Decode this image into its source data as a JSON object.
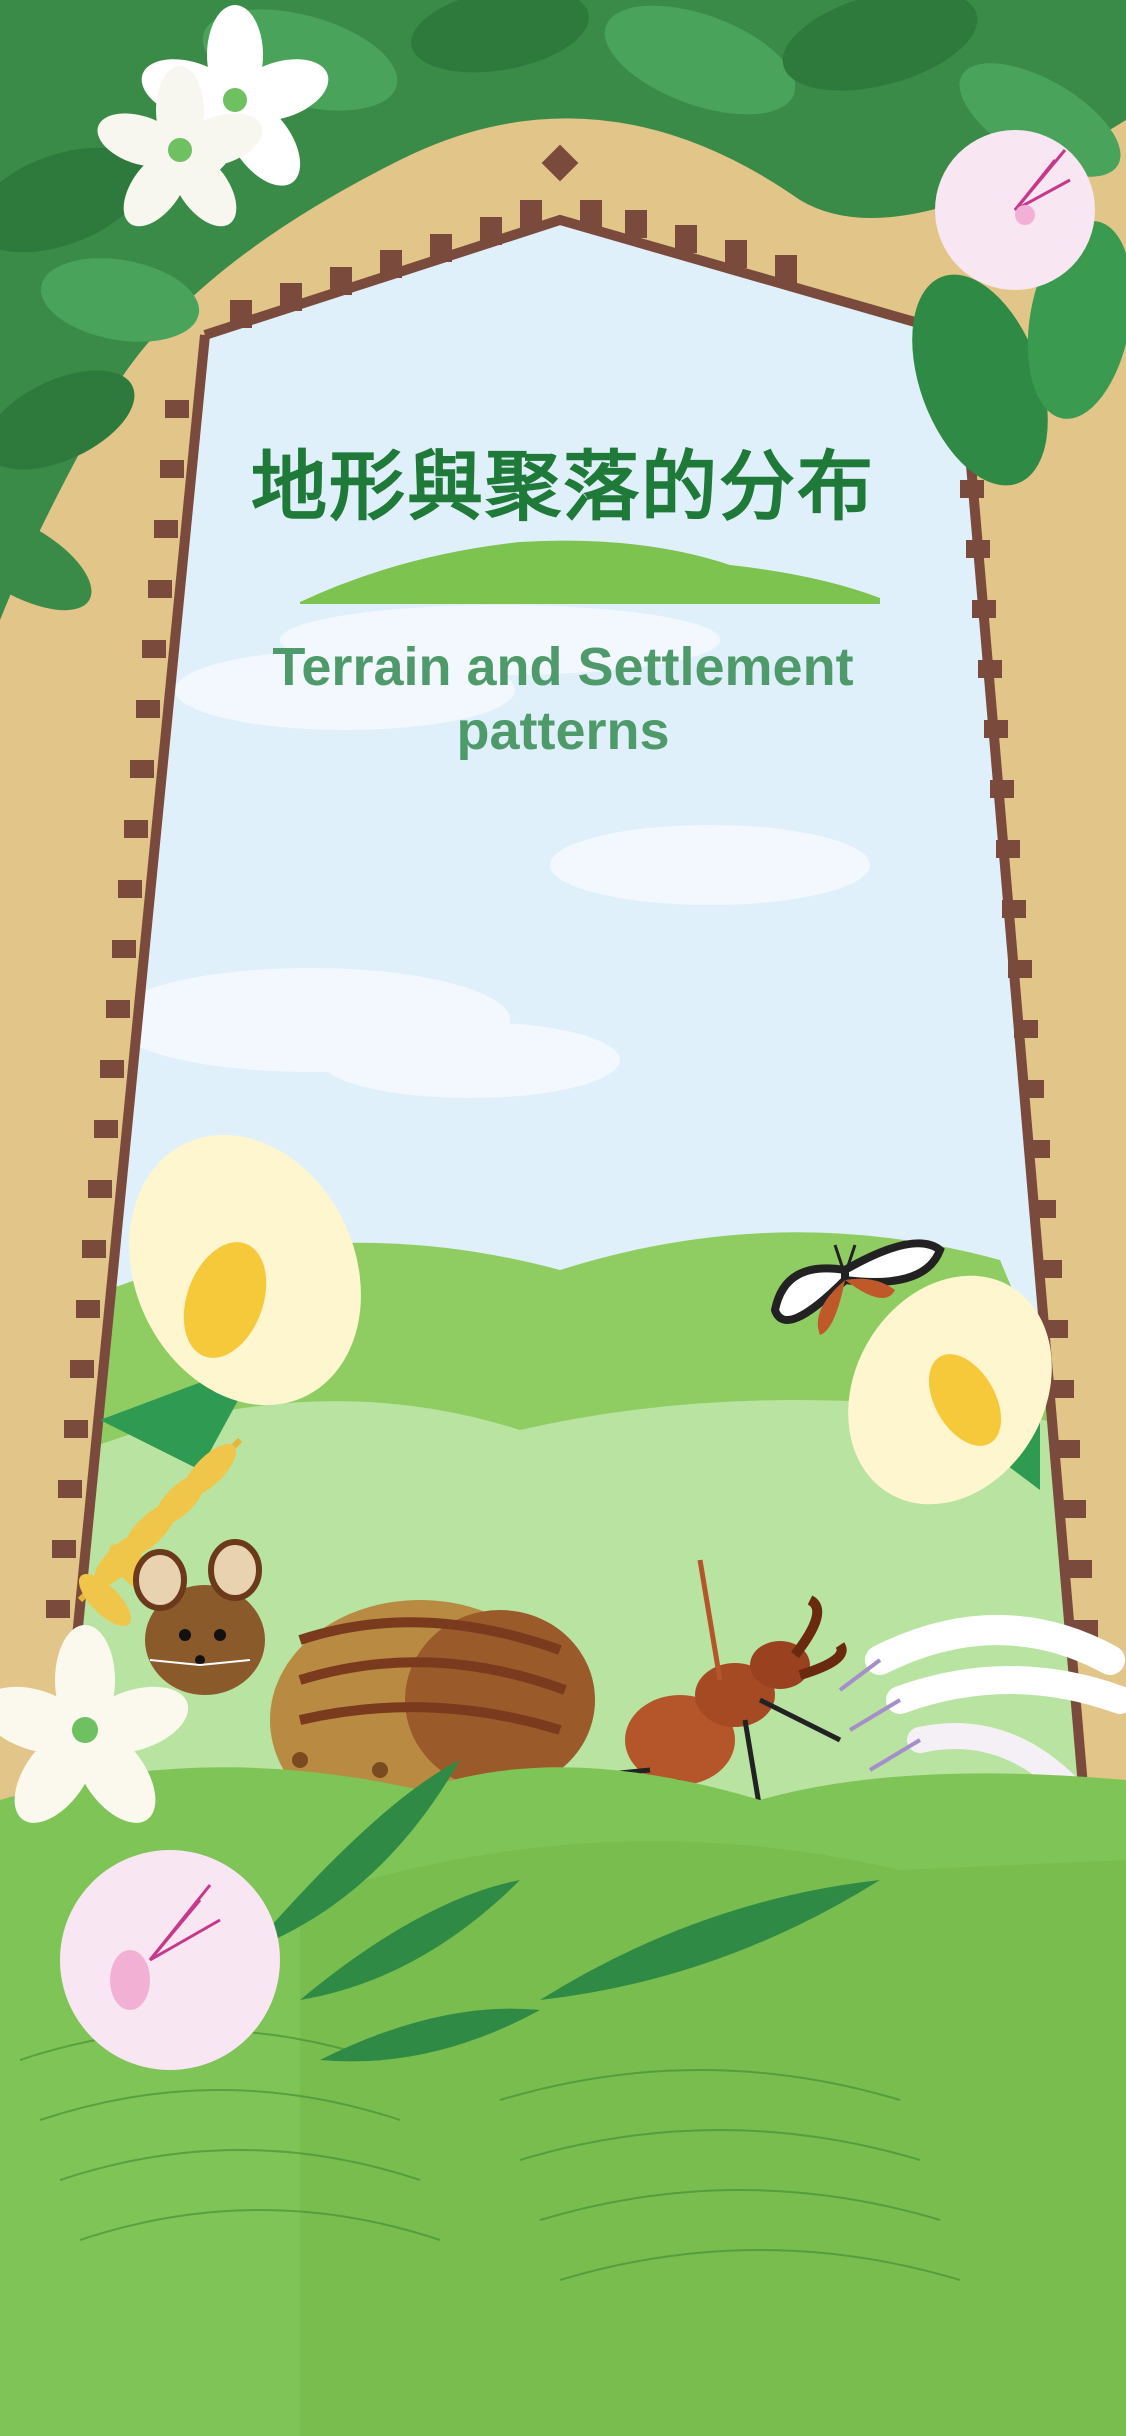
{
  "poster": {
    "title_zh": "地形與聚落的分布",
    "title_en_line1": "Terrain and Settlement",
    "title_en_line2": "patterns"
  },
  "colors": {
    "background_sand": "#e2c588",
    "sky": "#dff0fb",
    "frame_brown": "#7a4a3c",
    "leaf_dark": "#2f7d3f",
    "grass_light": "#b9e3a0",
    "grass_mid": "#7fc456",
    "title_green": "#1f7a3a",
    "subtitle_green": "#4e9a6a"
  },
  "illustrations": [
    "white-flower-icon",
    "pink-flower-icon",
    "calla-lily-icon",
    "butterfly-icon",
    "stag-beetle-icon",
    "chipmunk-icon",
    "honeysuckle-icon",
    "wheat-icon"
  ]
}
